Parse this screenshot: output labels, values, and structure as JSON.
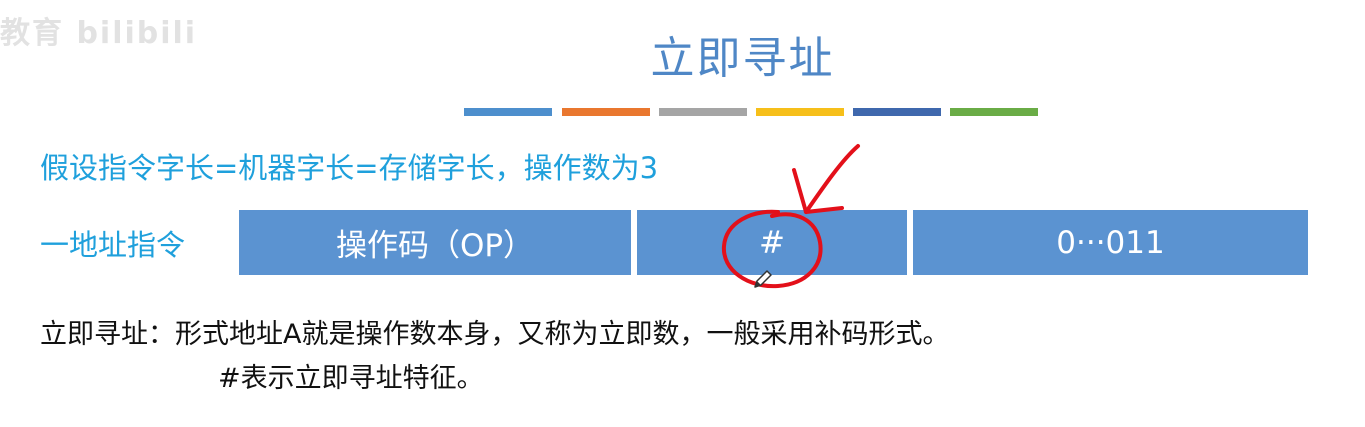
{
  "watermark": "教育 bilibili",
  "slide": {
    "title": "立即寻址",
    "intro": "假设指令字长=机器字长=存储字长，操作数为3",
    "row_label": "一地址指令",
    "fields": [
      {
        "label": "操作码（OP）"
      },
      {
        "label": "#"
      },
      {
        "label": "0···011"
      }
    ],
    "description_line1": "立即寻址：形式地址A就是操作数本身，又称为立即数，一般采用补码形式。",
    "description_line2": "#表示立即寻址特征。"
  },
  "colors": {
    "title": "#4f87c6",
    "accent_text": "#1fa0dc",
    "field_fill": "#5b93d1",
    "annotation": "#e3101a",
    "stripes": [
      "#4d8fcd",
      "#e9772f",
      "#a5a5a5",
      "#f6bf1a",
      "#3f68ad",
      "#6aac46"
    ]
  }
}
